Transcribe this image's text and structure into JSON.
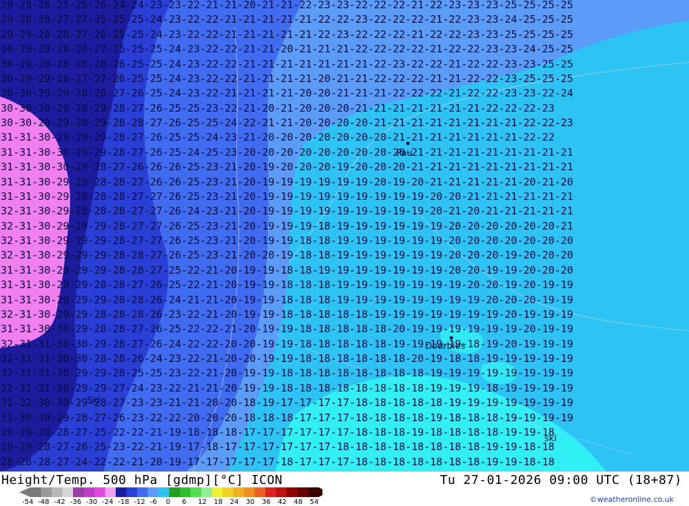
{
  "footer": {
    "title": "Height/Temp. 500 hPa [gdmp][°C] ICON",
    "datetime": "Tu 27-01-2026 09:00 UTC (18+87)",
    "credit": "©weatheronline.co.uk"
  },
  "legend": {
    "ticks": [
      "-54",
      "-48",
      "-42",
      "-36",
      "-30",
      "-24",
      "-18",
      "-12",
      "-6",
      "0",
      "6",
      "12",
      "18",
      "24",
      "30",
      "36",
      "42",
      "48",
      "54"
    ],
    "colors": [
      "#7a7a7a",
      "#9a9a9a",
      "#b8b8b8",
      "#d6d6d6",
      "#9b3fa6",
      "#c23dc7",
      "#e04ae0",
      "#f59df0",
      "#1c1c9e",
      "#2a3fd6",
      "#3f6cf0",
      "#5a9cf7",
      "#2ec3f5",
      "#20a020",
      "#30c030",
      "#50e050",
      "#90f090",
      "#f0f030",
      "#f0d020",
      "#f0b020",
      "#f09020",
      "#f06020",
      "#e02020",
      "#c01010",
      "#900000",
      "#6a0000",
      "#3a0000"
    ]
  },
  "places": [
    {
      "name": "Pau"
    },
    {
      "name": "Dourbies"
    },
    {
      "name": "Ski"
    },
    {
      "name": "ski"
    }
  ],
  "map_colors": {
    "pink": "#f07ff0",
    "deep_blue": "#1c1c9e",
    "blue": "#2a3fd6",
    "mid_blue": "#3f6cf0",
    "light_blue": "#5a9cf7",
    "cyan": "#2ec3f5",
    "aqua": "#30f0f5"
  },
  "temperature_rows": [
    "-29-29-28-25-25-26-24-24-23-23-22-21-21-20-21-21-22-23-23-22-22-22-21-22-23-23-23-25-25-25-25",
    "-29-28-28-27-27-25-25-25-24-23-22-22-21-21-21-21-21-22-22-23-22-22-22-21-22-23-23-24-25-25-25",
    "-29-29-28-28-27-26-25-25-24-23-22-22-21-21-21-21-21-22-23-22-22-22-21-22-22-23-23-25-25-25-25",
    "-30-29-28-28-28-27-25-25-25-24-23-22-22-21-21-20-21-21-21-22-22-22-22-21-22-22-23-23-24-25-25",
    "-30-29-28-28-28-28-26-25-25-24-23-22-22-21-21-21-21-21-21-21-22-23-22-22-21-22-22-23-23-25-25",
    "-30-29-29-28-27-27-26-25-25-24-23-22-22-21-21-21-21-20-21-21-22-22-22-21-21-22-22-23-25-25-25",
    "-30-30-29-29-28-28-27-26-25-24-23-22-21-21-21-21-20-20-21-21-21-22-22-22-21-22-22-23-23-22-24",
    "-30-30-30-29-28-29-28-27-26-25-25-23-22-21-20-21-20-20-20-21-21-21-21-21-21-21-22-22-22-23",
    "-30-30-29-29-28-29-28-28-27-26-25-25-24-22-21-21-20-20-20-20-21-21-21-21-21-21-21-21-22-22-23",
    "-31-31-30-29-29-29-28-27-26-25-25-24-23-21-20-20-20-20-20-20-20-21-21-21-21-21-21-21-22-22",
    "-31-31-30-30-29-29-28-27-26-25-24-25-23-20-20-20-20-20-20-20-20-20-21-21-21-21-21-21-21-21-21",
    "-31-31-30-30-29-28-27-26-26-26-25-23-21-20-19-20-20-20-19-20-20-20-21-21-21-21-21-21-21-21-21",
    "-31-31-30-29-29-28-28-27-26-26-25-23-21-20-19-19-19-19-19-19-20-19-20-21-21-21-21-21-20-21-20",
    "-31-31-30-29-28-28-28-27-27-26-25-23-21-20-19-19-19-19-19-19-19-19-19-20-20-21-21-21-21-21-21",
    "-32-31-30-29-28-28-28-27-27-26-24-23-21-20-19-19-19-19-19-19-19-19-19-20-21-20-21-21-21-21-21",
    "-32-31-30-29-29-29-28-27-27-26-25-23-21-20-19-19-19-18-19-19-19-19-19-19-20-20-20-20-20-20-21",
    "-32-31-30-29-29-29-28-27-27-26-25-23-21-20-19-19-18-18-19-19-19-19-19-19-20-20-20-20-20-20-20",
    "-32-31-30-29-29-29-28-28-27-26-25-23-21-20-20-19-18-18-19-19-19-19-19-19-20-20-20-19-20-20-20",
    "-31-31-30-29-29-29-28-28-27-25-22-21-20-19-19-18-18-19-19-19-19-19-19-19-20-20-19-19-20-20-20",
    "-31-31-30-29-29-28-28-27-26-25-22-21-20-19-19-18-18-18-19-19-19-19-19-19-19-20-20-19-20-19-19",
    "-31-31-30-29-29-29-28-28-26-24-21-21-20-19-19-18-18-18-19-19-19-19-19-19-19-19-20-20-20-19-19",
    "-32-31-30-29-29-28-28-28-26-23-22-21-20-19-19-18-18-18-18-18-19-19-19-19-19-19-19-20-19-19-19",
    "-31-31-30-30-29-28-28-27-26-25-22-22-21-20-19-19-18-18-18-18-18-20-19-19-19-19-19-19-20-19-19",
    "-32-31-31-30-30-29-28-27-26-24-22-22-20-20-19-19-18-18-18-18-18-19-19-19-19-18-19-20-19-19-19",
    "-32-31-31-30-30-28-28-26-24-23-22-21-20-20-19-19-18-18-18-18-18-18-20-19-18-18-19-19-19-19-19",
    "-32-31-31-30-29-29-28-25-25-23-22-21-20-19-19-18-18-18-18-18-18-18-18-19-19-19-19-19-19-19-19",
    "-32-31-31-30-29-29-27-24-23-22-21-21-20-19-19-18-18-18-18-18-18-18-18-19-19-19-18-19-19-19-19",
    "-31-32-30-30-29-28-27-23-23-21-21-20-20-18-19-17-17-17-17-18-18-18-18-18-19-19-19-19-19-19-19",
    "-31-30-30-29-28-27-26-23-22-22-20-20-20-18-18-18-17-17-17-18-18-18-18-19-18-18-18-19-19-19-19",
    "-29-29-28-28-27-25-22-22-21-19-18-18-18-17-17-17-17-17-17-18-18-18-19-18-18-18-18-19-19-18",
    "-29-29-28-27-26-25-23-22-21-19-17-18-17-17-17-17-17-17-18-18-18-18-18-18-18-18-19-19-18-18",
    "-28-28-28-27-24-22-22-21-20-19-17-17-17-17-17-18-17-17-17-18-18-18-18-18-18-18-19-19-18-18"
  ]
}
